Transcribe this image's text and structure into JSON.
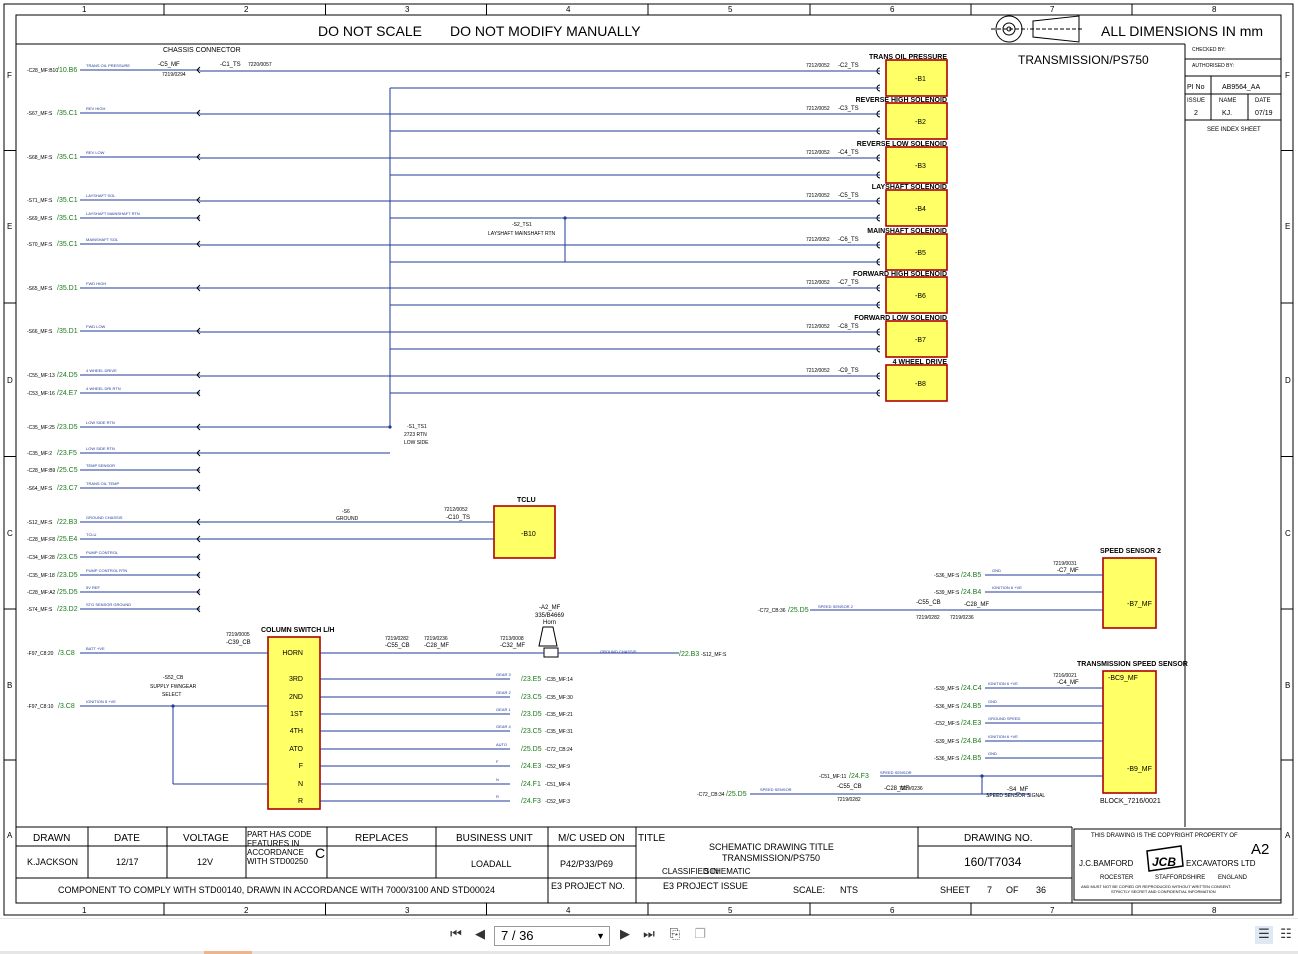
{
  "header": {
    "notice_scale": "DO NOT SCALE",
    "notice_modify": "DO NOT MODIFY MANUALLY",
    "dimensions": "ALL DIMENSIONS IN mm",
    "drawing_title": "TRANSMISSION/PS750"
  },
  "grid": {
    "columns": [
      "1",
      "2",
      "3",
      "4",
      "5",
      "6",
      "7",
      "8"
    ],
    "rows": [
      "F",
      "E",
      "D",
      "C",
      "B",
      "A"
    ]
  },
  "approvals": {
    "checked_by": "CHECKED BY:",
    "authorised_by": "AUTHORISED BY:",
    "pi_no_label": "PI No",
    "pi_no_value": "AB9564_AA",
    "issue_label": "ISSUE",
    "issue_value": "2",
    "name_label": "NAME",
    "name_value": "KJ.",
    "date_label": "DATE",
    "date_value": "07/19",
    "index_note": "SEE INDEX SHEET"
  },
  "components": [
    {
      "title": "TRANS OIL PRESSURE",
      "id": "-B1",
      "conn": "-C2_TS",
      "part": "7212/0052"
    },
    {
      "title": "REVERSE HIGH SOLENOID",
      "id": "-B2",
      "conn": "-C3_TS",
      "part": "7212/0052"
    },
    {
      "title": "REVERSE LOW SOLENOID",
      "id": "-B3",
      "conn": "-C4_TS",
      "part": "7212/0052"
    },
    {
      "title": "LAYSHAFT SOLENOID",
      "id": "-B4",
      "conn": "-C5_TS",
      "part": "7212/0052"
    },
    {
      "title": "MAINSHAFT SOLENOID",
      "id": "-B5",
      "conn": "-C6_TS",
      "part": "7212/0052"
    },
    {
      "title": "FORWARD HIGH SOLENOID",
      "id": "-B6",
      "conn": "-C7_TS",
      "part": "7212/0052"
    },
    {
      "title": "FORWARD LOW SOLENOID",
      "id": "-B7",
      "conn": "-C8_TS",
      "part": "7212/0052"
    },
    {
      "title": "4 WHEEL DRIVE",
      "id": "-B8",
      "conn": "-C9_TS",
      "part": "7212/0052"
    }
  ],
  "left_signals": [
    {
      "ref": "-C28_MF:B10",
      "link": "/10.B6",
      "name": "TRANS OIL PRESSURE"
    },
    {
      "ref": "-S67_MF:S",
      "link": "/35.C1",
      "name": "REV HIGH"
    },
    {
      "ref": "-S68_MF:S",
      "link": "/35.C1",
      "name": "REV LOW"
    },
    {
      "ref": "-S71_MF:S",
      "link": "/35.C1",
      "name": "LAYSHAFT SOL"
    },
    {
      "ref": "-S69_MF:S",
      "link": "/35.C1",
      "name": "LAYSHAFT MAINSHAFT RTN"
    },
    {
      "ref": "-S70_MF:S",
      "link": "/35.C1",
      "name": "MAINSHAFT SOL"
    },
    {
      "ref": "-S65_MF:S",
      "link": "/35.D1",
      "name": "FWD HIGH"
    },
    {
      "ref": "-S66_MF:S",
      "link": "/35.D1",
      "name": "FWD LOW"
    },
    {
      "ref": "-C55_MF:13",
      "link": "/24.D5",
      "name": "4 WHEEL DRIVE"
    },
    {
      "ref": "-C53_MF:16",
      "link": "/24.E7",
      "name": "4 WHEEL DRI RTN"
    },
    {
      "ref": "-C35_MF:25",
      "link": "/23.D5",
      "name": "LOW SIDE RTN"
    },
    {
      "ref": "-C35_MF:2",
      "link": "/23.F5",
      "name": "LOW SIDE RTN"
    },
    {
      "ref": "-C28_MF:B9",
      "link": "/25.C5",
      "name": "TEMP SENSOR"
    },
    {
      "ref": "-S64_MF:S",
      "link": "/23.C7",
      "name": "TRANS OIL TEMP"
    },
    {
      "ref": "-S12_MF:S",
      "link": "/22.B3",
      "name": "GROUND CHASSIS"
    },
    {
      "ref": "-C28_MF:F8",
      "link": "/25.E4",
      "name": "TCLU"
    },
    {
      "ref": "-C34_MF:28",
      "link": "/23.C5",
      "name": "PUMP CONTROL"
    },
    {
      "ref": "-C35_MF:18",
      "link": "/23.D5",
      "name": "PUMP CONTROL RTN"
    },
    {
      "ref": "-C28_MF:A2",
      "link": "/25.D5",
      "name": "5V REF"
    },
    {
      "ref": "-S74_MF:S",
      "link": "/23.D2",
      "name": "STG SENSOR GROUND"
    }
  ],
  "chassis": {
    "title": "CHASSIS CONNECTOR",
    "c5": "-C5_MF",
    "c1": "-C1_TS",
    "p1": "7219/0294",
    "p2": "7220/0057"
  },
  "junctions": {
    "s2": "-S2_TS1",
    "s2_label": "LAYSHAFT MAINSHAFT RTN",
    "s1": "-S1_TS1",
    "s1_sub": "2723 RTN",
    "s1_label": "LOW SIDE",
    "s6": "-S6",
    "s6_label": "GROUND"
  },
  "tclu": {
    "title": "TCLU",
    "id": "-B10",
    "conn": "-C10_TS",
    "part": "7212/0052"
  },
  "column_switch": {
    "title": "COLUMN SWITCH L/H",
    "conn": "-C39_CB",
    "part": "7219/0005",
    "positions": [
      "HORN",
      "3RD",
      "2ND",
      "1ST",
      "4TH",
      "ATO",
      "F",
      "N",
      "R"
    ],
    "left_refs": [
      {
        "ref": "-F97_C8:20",
        "link": "/3.C8",
        "name": "BATT +VE"
      },
      {
        "ref": "-F97_C8:10",
        "link": "/3.C8",
        "name": "IGNITION 5 +VE"
      }
    ],
    "s52": "-S52_CB",
    "s52_label1": "SUPPLY FWNGEAR",
    "s52_label2": "SELECT",
    "c55": "-C55_CB",
    "c28": "-C28_MF",
    "c32": "-C32_MF",
    "p55": "7219/0282",
    "p28": "7219/0236",
    "p32": "7213/0008",
    "horn_ref": "-A2_MF",
    "horn_part": "335/B4669",
    "horn_label": "Horn",
    "horn_out": "/22.B3",
    "horn_out_ref": "-S12_MF:S",
    "horn_out_name": "GROUND CHASSIS",
    "outputs": [
      {
        "name": "GEAR 3",
        "link": "/23.E5",
        "ref": "-C35_MF:14"
      },
      {
        "name": "GEAR 2",
        "link": "/23.C5",
        "ref": "-C35_MF:30"
      },
      {
        "name": "GEAR 1",
        "link": "/23.D5",
        "ref": "-C35_MF:21"
      },
      {
        "name": "GEAR 4",
        "link": "/23.C5",
        "ref": "-C35_MF:31"
      },
      {
        "name": "AUTO",
        "link": "/25.D5",
        "ref": "-C72_CB:24"
      },
      {
        "name": "F",
        "link": "/24.E3",
        "ref": "-C52_MF:9"
      },
      {
        "name": "N",
        "link": "/24.F1",
        "ref": "-C51_MF:4"
      },
      {
        "name": "R",
        "link": "/24.F3",
        "ref": "-C52_MF:3"
      }
    ]
  },
  "speed_sensor_2": {
    "title": "SPEED SENSOR 2",
    "id": "-B7_MF",
    "conn": "-C7_MF",
    "part": "7219/0031",
    "inputs": [
      {
        "ref": "-S36_MF:S",
        "link": "/24.B5",
        "name": "GND"
      },
      {
        "ref": "-S39_MF:S",
        "link": "/24.B4",
        "name": "IGNITION 6 +VE"
      }
    ],
    "cable_ref": "-C72_CB:36",
    "cable_link": "/25.D5",
    "cable_name": "SPEED SENSOR 2",
    "c55": "-C55_CB",
    "c28": "-C28_MF",
    "p55": "7219/0282",
    "p28": "7219/0236"
  },
  "trans_speed_sensor": {
    "title": "TRANSMISSION SPEED SENSOR",
    "id1": "-BC9_MF",
    "id2": "-B9_MF",
    "conn": "-C4_MF",
    "part": "7216/0021",
    "block": "BLOCK_7216/0021",
    "inputs": [
      {
        "ref": "-S39_MF:S",
        "link": "/24.C4",
        "name": "IGNITION 6 +VE"
      },
      {
        "ref": "-S36_MF:S",
        "link": "/24.B5",
        "name": "GND"
      },
      {
        "ref": "-C52_MF:S",
        "link": "/24.E3",
        "name": "GROUND SPEED"
      },
      {
        "ref": "-S39_MF:S",
        "link": "/24.B4",
        "name": "IGNITION 6 +VE"
      },
      {
        "ref": "-S36_MF:S",
        "link": "/24.B5",
        "name": "GND"
      }
    ],
    "c51": "-C51_MF:11",
    "c51_link": "/24.F3",
    "c51_name": "SPEED SENSOR",
    "cable_ref": "-C72_CB:34",
    "cable_link": "/25.D5",
    "cable_name": "SPEED SENSOR",
    "c55": "-C55_CB",
    "c28": "-C28_MF",
    "p55": "7219/0282",
    "p28": "7219/0236",
    "s4": "-S4_MF",
    "s4_label": "SPEED SENSOR SIGNAL"
  },
  "title_block": {
    "drawn_label": "DRAWN",
    "drawn_value": "K.JACKSON",
    "date_label": "DATE",
    "date_value": "12/17",
    "voltage_label": "VOLTAGE",
    "voltage_value": "12V",
    "part_code_label": "PART HAS CODE FEATURES IN ACCORDANCE WITH STD00250",
    "part_code_value": "C",
    "replaces_label": "REPLACES",
    "business_unit_label": "BUSINESS UNIT",
    "business_unit_value": "LOADALL",
    "mc_used_label": "M/C USED ON",
    "mc_used_value": "P42/P33/P69",
    "title_label": "TITLE",
    "title_value_1": "SCHEMATIC DRAWING TITLE",
    "title_value_2": "TRANSMISSION/PS750",
    "classified_label": "CLASSIFIED IN",
    "classified_value": "SCHEMATIC",
    "drawing_no_label": "DRAWING NO.",
    "drawing_no_value": "160/T7034",
    "size": "A2",
    "copyright_1": "THIS DRAWING IS THE COPYRIGHT PROPERTY OF",
    "company_left": "J.C.BAMFORD",
    "company_right": "EXCAVATORS LTD",
    "logo_text": "JCB",
    "address_1": "ROCESTER",
    "address_2": "STAFFORDSHIRE",
    "address_3": "ENGLAND",
    "copyright_2": "AND MUST NOT BE COPIED OR REPRODUCED WITHOUT WRITTEN CONSENT.",
    "copyright_3": "STRICTLY SECRET AND CONFIDENTIAL INFORMATION",
    "comply_note": "COMPONENT TO COMPLY WITH STD00140, DRAWN IN ACCORDANCE WITH 7000/3100 AND STD00024",
    "e3_project_label": "E3 PROJECT NO.",
    "e3_issue_label": "E3 PROJECT ISSUE",
    "scale_label": "SCALE:",
    "scale_value": "NTS",
    "sheet_label": "SHEET",
    "sheet_value": "7",
    "of_label": "OF",
    "sheet_total": "36"
  },
  "viewer": {
    "page_display": "7 / 36",
    "current_page": 7,
    "total_pages": 36,
    "progress_fraction": 0.194
  }
}
